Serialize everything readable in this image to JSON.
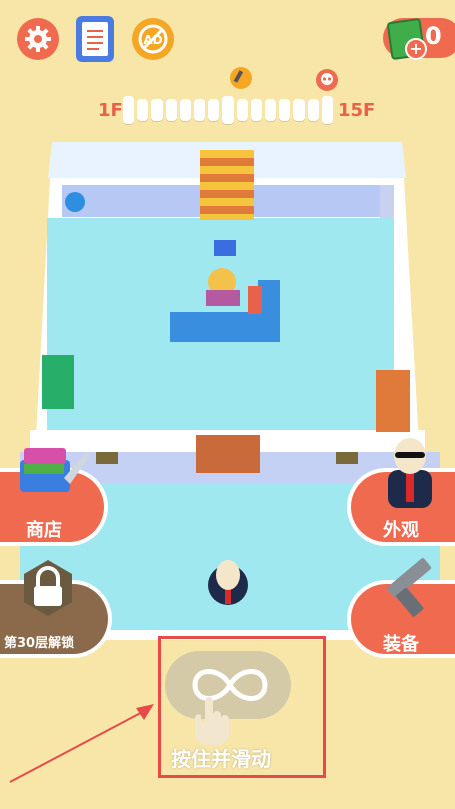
{
  "hud": {
    "cash_count": "0",
    "icons": [
      "gear-icon",
      "notebook-icon",
      "no-ads-icon",
      "cash-icon"
    ]
  },
  "floors": {
    "start_label": "1F",
    "end_label": "15F",
    "segments": 15,
    "current": 1
  },
  "menu": {
    "shop_label": "商店",
    "skin_label": "外观",
    "equip_label": "装备",
    "unlock_label": "第30层解锁"
  },
  "hint": {
    "text": "按住并滑动"
  },
  "colors": {
    "background": "#f7e6a8",
    "accent": "#f06a50",
    "floor": "#9fe8f0",
    "highlight": "#e84a4a"
  }
}
